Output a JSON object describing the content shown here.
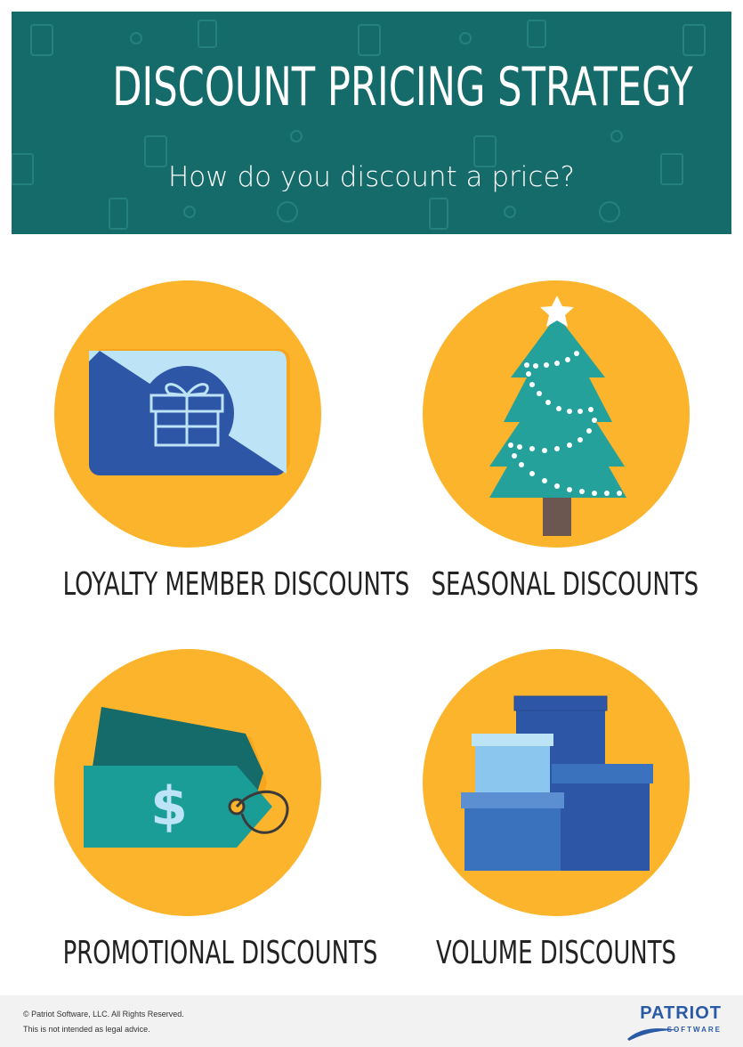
{
  "header": {
    "title": "DISCOUNT PRICING STRATEGY",
    "subtitle": "How do you discount a price?"
  },
  "items": [
    {
      "label": "LOYALTY MEMBER DISCOUNTS",
      "icon": "gift-card-icon"
    },
    {
      "label": "SEASONAL DISCOUNTS",
      "icon": "christmas-tree-icon"
    },
    {
      "label": "PROMOTIONAL DISCOUNTS",
      "icon": "price-tag-icon",
      "tag_symbol": "$"
    },
    {
      "label": "VOLUME DISCOUNTS",
      "icon": "stacked-boxes-icon"
    }
  ],
  "footer": {
    "copyright": "© Patriot Software, LLC. All Rights Reserved.",
    "disclaimer": "This is not intended as legal advice.",
    "brand_name": "PATRIOT",
    "brand_sub": "SOFTWARE"
  },
  "colors": {
    "header_bg": "#156b6a",
    "circle": "#fbb42b",
    "teal": "#24a19b",
    "blue_dark": "#2d56a6",
    "blue_light": "#bde3f7",
    "brand": "#2a5aa6"
  }
}
